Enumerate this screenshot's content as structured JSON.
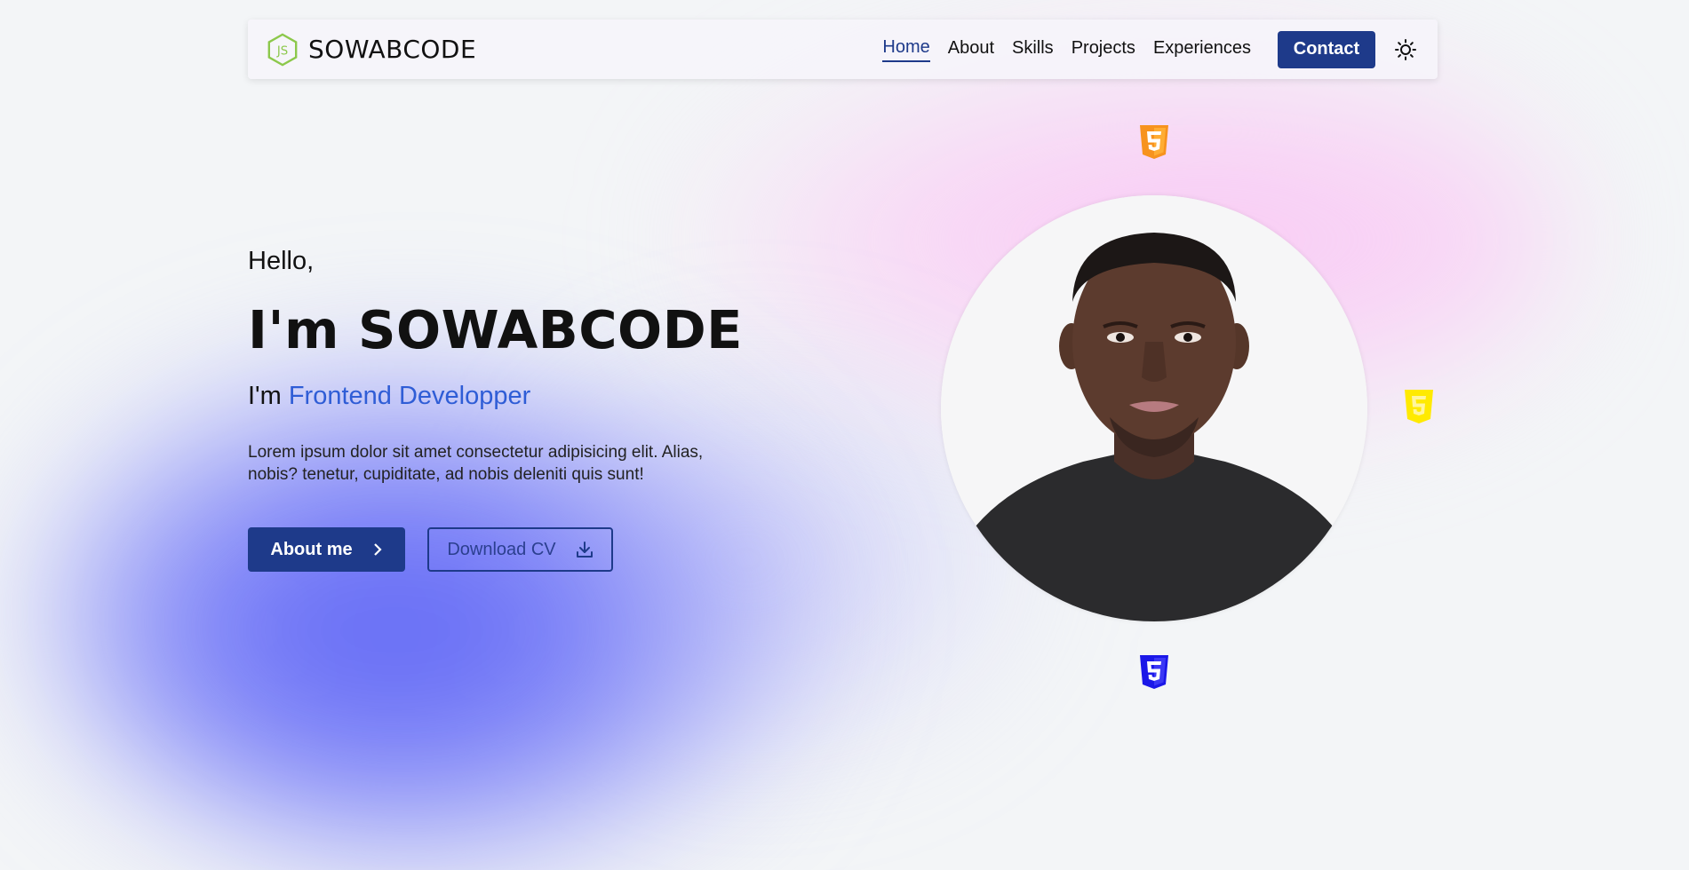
{
  "colors": {
    "primary": "#1e3a8a",
    "accent_text": "#2f5dd6",
    "html_badge": "#f7931e",
    "js_badge": "#ffea00",
    "css_badge": "#1b18e8",
    "logo_green": "#8cc84b"
  },
  "navbar": {
    "logo_icon": "js-hexagon-icon",
    "brand": "SOWABCODE",
    "links": [
      "Home",
      "About",
      "Skills",
      "Projects",
      "Experiences"
    ],
    "active_link": "Home",
    "contact_label": "Contact",
    "theme_icon": "sun-icon"
  },
  "hero": {
    "greeting": "Hello,",
    "headline": "I'm SOWABCODE",
    "role_prefix": "I'm",
    "role": "Frontend Developper",
    "description": "Lorem ipsum dolor sit amet consectetur adipisicing elit. Alias, nobis? tenetur, cupiditate, ad nobis deleniti quis sunt!",
    "about_button": "About me",
    "about_icon": "chevron-right-icon",
    "cv_button": "Download CV",
    "cv_icon": "download-icon"
  },
  "portrait": {
    "icons": [
      "html5-icon",
      "js-shield-icon",
      "css3-icon"
    ]
  }
}
